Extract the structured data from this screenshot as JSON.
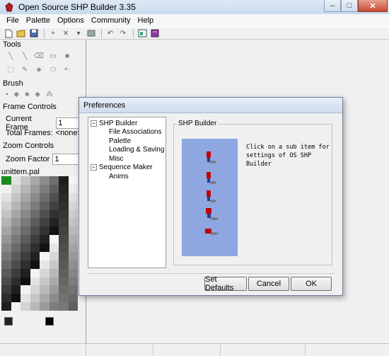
{
  "window": {
    "title": "Open Source SHP Builder 3.35"
  },
  "menu": [
    "File",
    "Palette",
    "Options",
    "Community",
    "Help"
  ],
  "left_panel": {
    "tools_label": "Tools",
    "brush_label": "Brush",
    "frame_controls_label": "Frame Controls",
    "current_frame_label": "Current Frame",
    "current_frame_value": "1",
    "total_frames_label": "Total Frames:",
    "total_frames_value": "<none>",
    "zoom_controls_label": "Zoom Controls",
    "zoom_factor_label": "Zoom Factor",
    "zoom_factor_value": "1",
    "palette_name": "unittem.pal"
  },
  "dialog": {
    "title": "Preferences",
    "tree": [
      {
        "label": "SHP Builder",
        "children": [
          "File Associations",
          "Palette",
          "Loading & Saving",
          "Misc"
        ]
      },
      {
        "label": "Sequence Maker",
        "children": [
          "Anims"
        ]
      }
    ],
    "group_title": "SHP Builder",
    "hint_text": "Click on a sub item for settings of OS SHP Builder",
    "buttons": {
      "set_defaults": "Set Defaults",
      "cancel": "Cancel",
      "ok": "OK"
    }
  },
  "colors": {
    "preview_bg": "#8ea7e0",
    "palette_accent": "#1a8a1a"
  }
}
